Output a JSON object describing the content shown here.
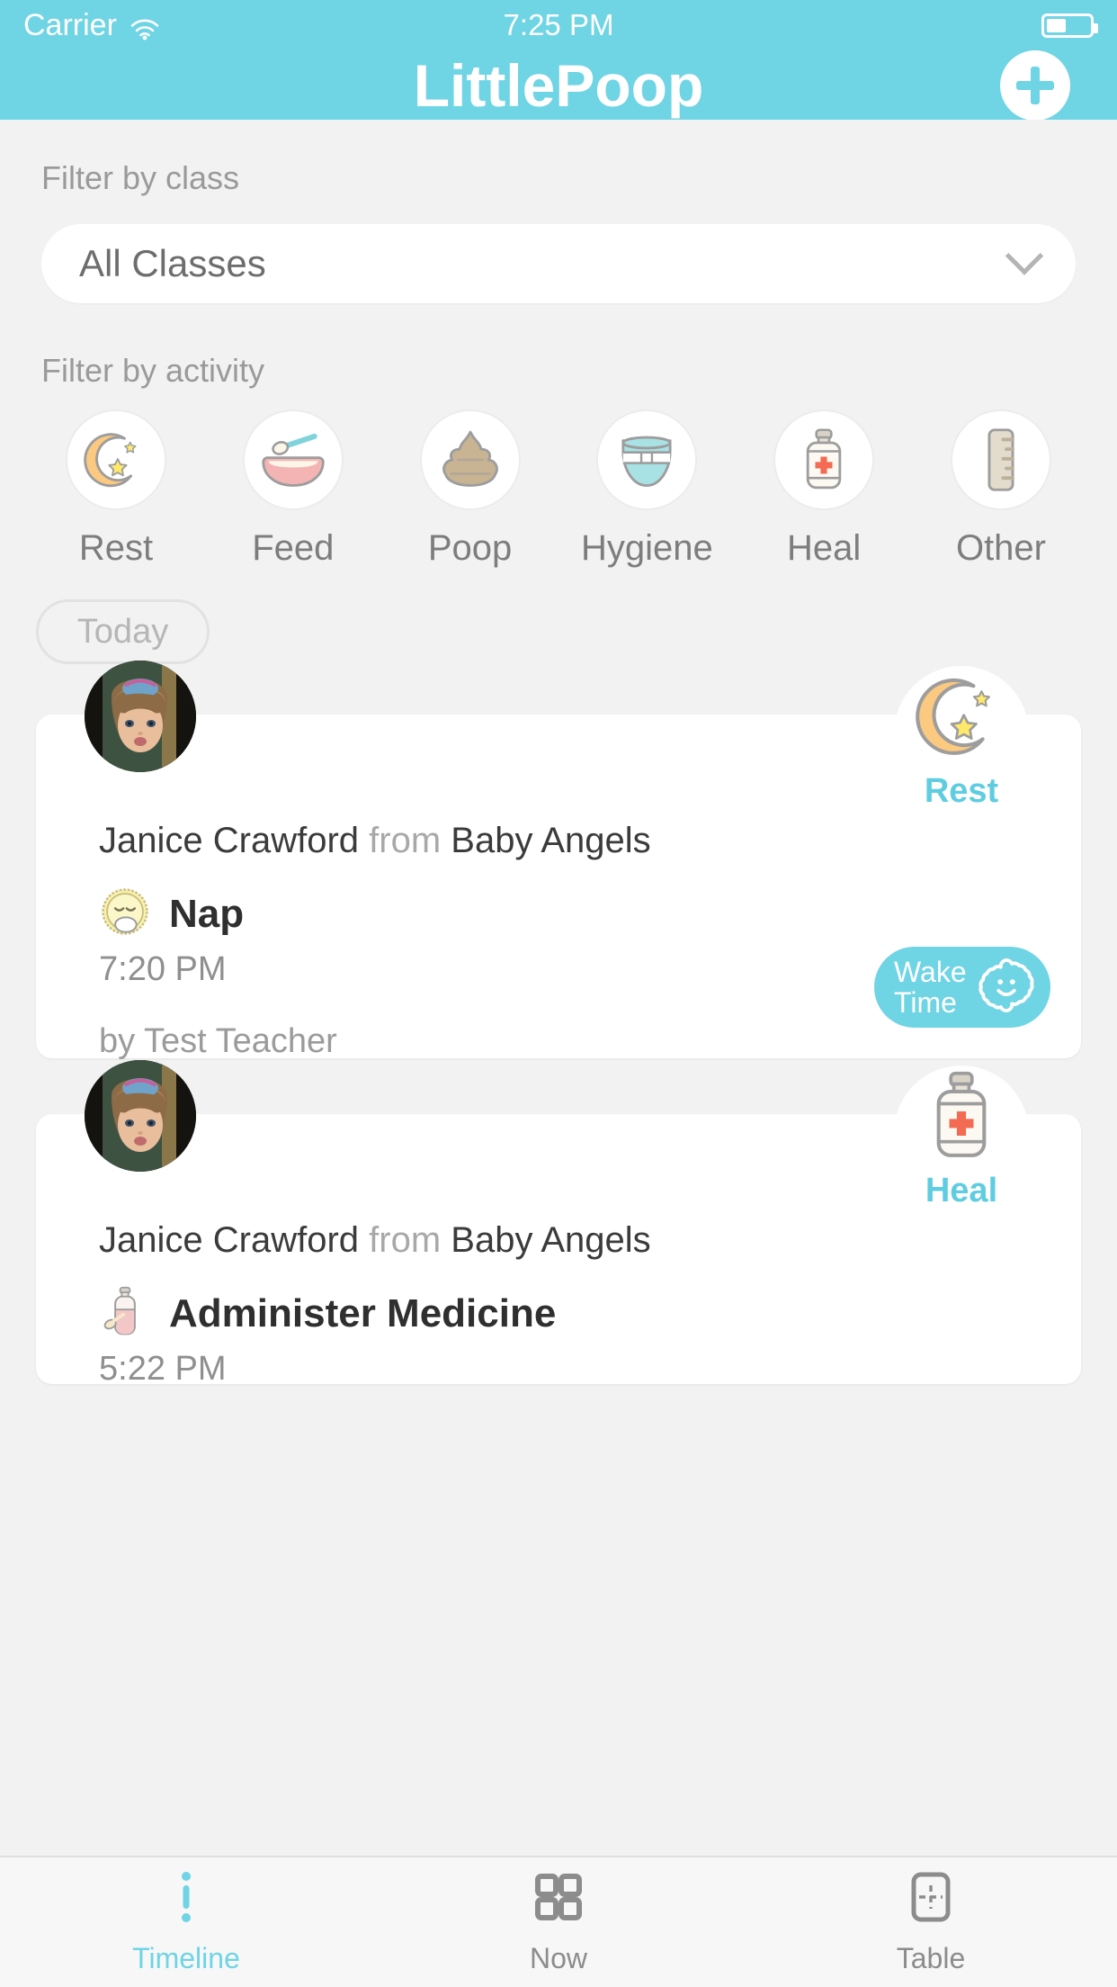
{
  "status_bar": {
    "carrier": "Carrier",
    "time": "7:25 PM",
    "wifi_icon": "wifi-icon",
    "battery_icon": "battery-icon"
  },
  "nav": {
    "title": "LittlePoop",
    "add_button_label": "+",
    "add_icon": "plus-icon"
  },
  "filters": {
    "class_label": "Filter by class",
    "class_value": "All Classes",
    "class_chevron_icon": "chevron-down-icon",
    "activity_label": "Filter by activity",
    "activities": [
      {
        "label": "Rest",
        "icon": "moon-stars-icon"
      },
      {
        "label": "Feed",
        "icon": "bowl-spoon-icon"
      },
      {
        "label": "Poop",
        "icon": "poop-icon"
      },
      {
        "label": "Hygiene",
        "icon": "diaper-icon"
      },
      {
        "label": "Heal",
        "icon": "medicine-bottle-icon"
      },
      {
        "label": "Other",
        "icon": "ruler-icon"
      }
    ]
  },
  "timeline": {
    "day_label": "Today",
    "entries": [
      {
        "child_name": "Janice Crawford",
        "from_word": "from",
        "class_name": "Baby Angels",
        "category": "Rest",
        "category_icon": "moon-stars-icon",
        "activity": "Nap",
        "activity_icon": "sleeping-sun-icon",
        "time": "7:20 PM",
        "byline": "by Test Teacher",
        "action_button": {
          "label_line1": "Wake",
          "label_line2": "Time",
          "icon": "sun-smile-icon"
        },
        "avatar": "child-avatar"
      },
      {
        "child_name": "Janice Crawford",
        "from_word": "from",
        "class_name": "Baby Angels",
        "category": "Heal",
        "category_icon": "medicine-bottle-icon",
        "activity": "Administer Medicine",
        "activity_icon": "medicine-bottle-pink-icon",
        "time": "5:22 PM",
        "avatar": "child-avatar"
      }
    ]
  },
  "tabbar": {
    "tabs": [
      {
        "label": "Timeline",
        "icon": "timeline-icon",
        "active": true
      },
      {
        "label": "Now",
        "icon": "grid-icon",
        "active": false
      },
      {
        "label": "Table",
        "icon": "table-icon",
        "active": false
      }
    ]
  },
  "colors": {
    "accent": "#6FD4E4",
    "accent_text": "#5FCDE0",
    "background": "#f2f2f2",
    "card": "#ffffff",
    "muted_text": "#9a9a9a"
  }
}
